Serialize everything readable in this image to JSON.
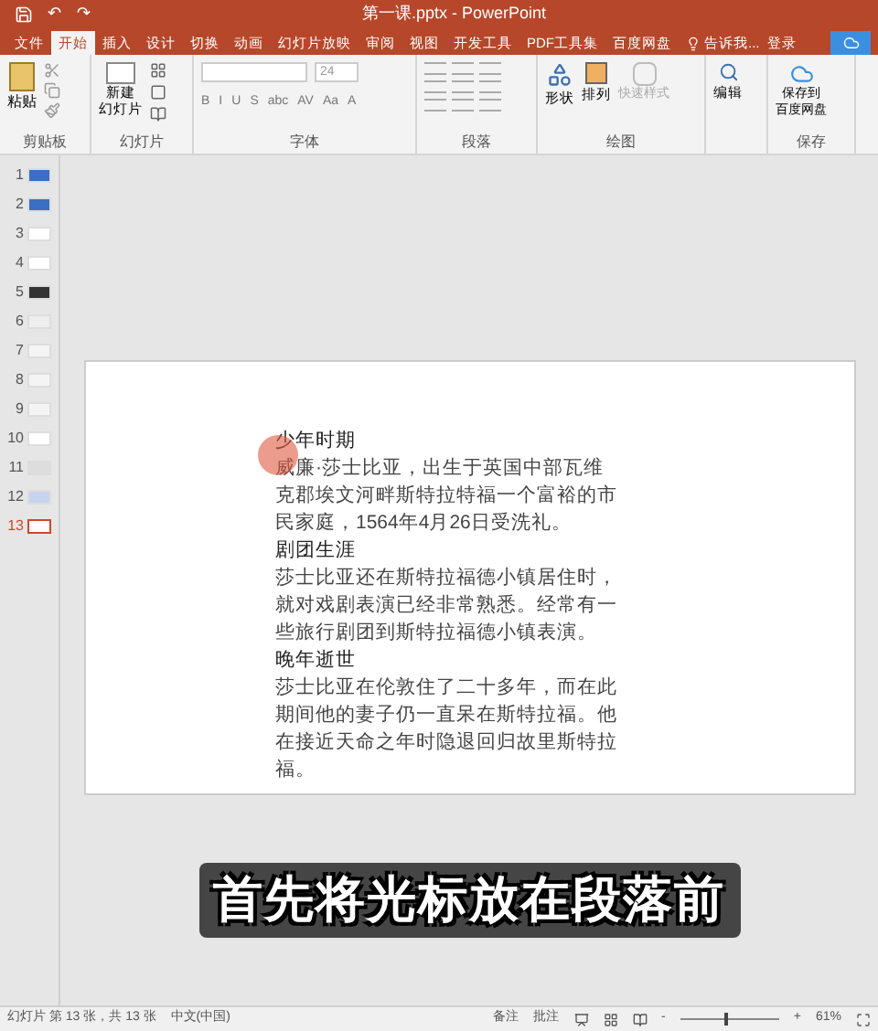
{
  "window": {
    "title": "第一课.pptx - PowerPoint"
  },
  "quick_access": [
    "↶",
    "↷"
  ],
  "tabs": [
    {
      "label": "文件",
      "selected": false
    },
    {
      "label": "开始",
      "selected": true
    },
    {
      "label": "插入",
      "selected": false
    },
    {
      "label": "设计",
      "selected": false
    },
    {
      "label": "切换",
      "selected": false
    },
    {
      "label": "动画",
      "selected": false
    },
    {
      "label": "幻灯片放映",
      "selected": false
    },
    {
      "label": "审阅",
      "selected": false
    },
    {
      "label": "视图",
      "selected": false
    },
    {
      "label": "开发工具",
      "selected": false
    },
    {
      "label": "PDF工具集",
      "selected": false
    },
    {
      "label": "百度网盘",
      "selected": false
    }
  ],
  "tell_me": "告诉我...",
  "sign_in": "登录",
  "ribbon": {
    "paste": "粘贴",
    "clipboard": "剪贴板",
    "new_slide": [
      "新建",
      "幻灯片"
    ],
    "slides": "幻灯片",
    "font_size": "24",
    "font_buttons": [
      "B",
      "I",
      "U",
      "S",
      "abc",
      "AV",
      "Aa",
      "A"
    ],
    "font": "字体",
    "paragraph": "段落",
    "shape": "形状",
    "arrange": "排列",
    "quick_styles": "快速样式",
    "drawing": "绘图",
    "edit": "编辑",
    "save_cloud": [
      "保存到",
      "百度网盘"
    ],
    "save": "保存"
  },
  "thumbnails": [
    {
      "number": "1",
      "selected": false
    },
    {
      "number": "2",
      "selected": false
    },
    {
      "number": "3",
      "selected": false
    },
    {
      "number": "4",
      "selected": false
    },
    {
      "number": "5",
      "selected": false
    },
    {
      "number": "6",
      "selected": false
    },
    {
      "number": "7",
      "selected": false
    },
    {
      "number": "8",
      "selected": false
    },
    {
      "number": "9",
      "selected": false
    },
    {
      "number": "10",
      "selected": false
    },
    {
      "number": "11",
      "selected": false
    },
    {
      "number": "12",
      "selected": false
    },
    {
      "number": "13",
      "selected": true
    }
  ],
  "slide": {
    "blocks": [
      {
        "kind": "heading",
        "text": "少年时期"
      },
      {
        "kind": "paragraph",
        "text": "威廉·莎士比亚，出生于英国中部瓦维克郡埃文河畔斯特拉特福一个富裕的市民家庭，1564年4月26日受洗礼。"
      },
      {
        "kind": "heading",
        "text": "剧团生涯"
      },
      {
        "kind": "paragraph",
        "text": "莎士比亚还在斯特拉福德小镇居住时，就对戏剧表演已经非常熟悉。经常有一些旅行剧团到斯特拉福德小镇表演。"
      },
      {
        "kind": "heading",
        "text": "晚年逝世"
      },
      {
        "kind": "paragraph",
        "text": "莎士比亚在伦敦住了二十多年，而在此期间他的妻子仍一直呆在斯特拉福。他在接近天命之年时隐退回归故里斯特拉福。"
      }
    ]
  },
  "subtitle": "首先将光标放在段落前",
  "status_bar": {
    "slide_info": "幻灯片 第 13 张，共 13 张",
    "language": "中文(中国)",
    "notes": "备注",
    "comments": "批注",
    "minus": "-",
    "plus": "+",
    "zoom": "61%",
    "level": 0.45
  }
}
